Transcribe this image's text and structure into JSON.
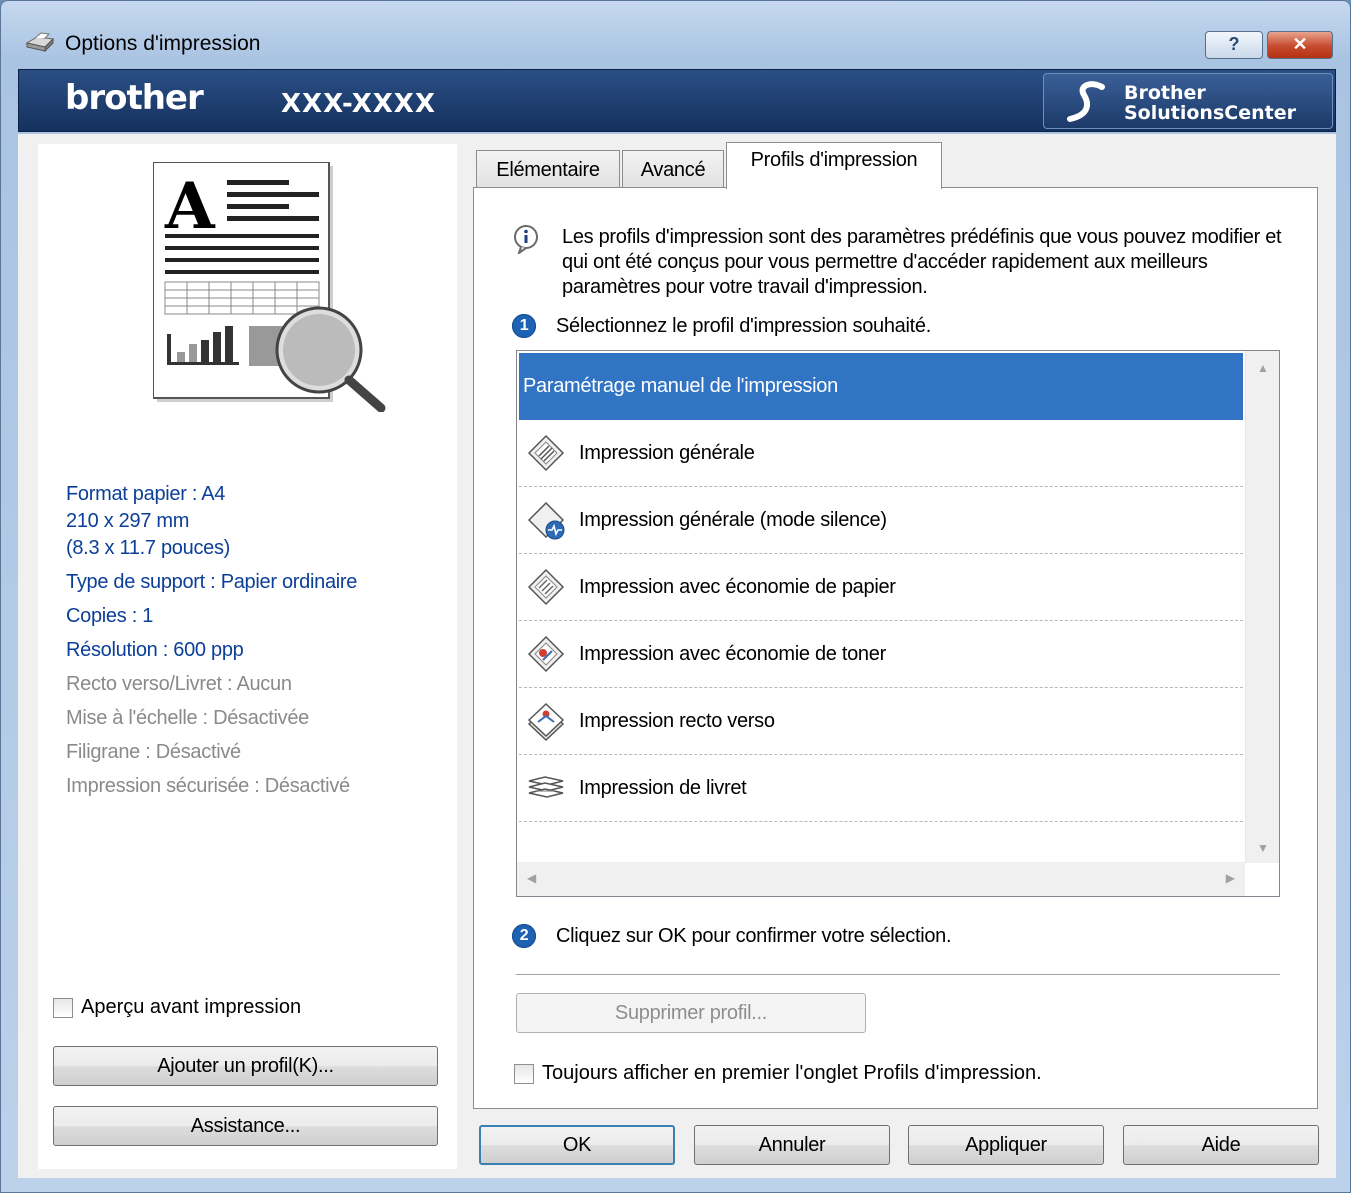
{
  "window": {
    "title": "Options d'impression",
    "help_label": "?",
    "close_label": "✕"
  },
  "banner": {
    "logo": "brother",
    "model": "XXX-XXXX",
    "solutions_line1": "Brother",
    "solutions_line2": "SolutionsCenter"
  },
  "summary": {
    "paper_size": "Format papier : A4",
    "paper_mm": "210 x 297 mm",
    "paper_in": "(8.3 x 11.7 pouces)",
    "media_type": "Type de support : Papier ordinaire",
    "copies": "Copies : 1",
    "resolution": "Résolution : 600 ppp",
    "duplex": "Recto verso/Livret : Aucun",
    "scaling": "Mise à l'échelle : Désactivée",
    "watermark": "Filigrane : Désactivé",
    "secure": "Impression sécurisée : Désactivé"
  },
  "left": {
    "preview_checkbox": "Aperçu avant impression",
    "add_profile": "Ajouter un profil(K)...",
    "support": "Assistance..."
  },
  "tabs": [
    {
      "label": "Elémentaire"
    },
    {
      "label": "Avancé"
    },
    {
      "label": "Profils d'impression"
    }
  ],
  "profiles_tab": {
    "description": "Les profils d'impression sont des paramètres prédéfinis que vous pouvez modifier et qui ont été conçus pour vous permettre d'accéder rapidement aux meilleurs paramètres pour votre travail d'impression.",
    "step1": "Sélectionnez le profil d'impression souhaité.",
    "items": [
      {
        "label": "Paramétrage manuel de l'impression",
        "icon": "none",
        "selected": true
      },
      {
        "label": "Impression générale",
        "icon": "general-print-icon"
      },
      {
        "label": "Impression générale (mode silence)",
        "icon": "quiet-mode-icon"
      },
      {
        "label": "Impression avec économie de papier",
        "icon": "paper-save-icon"
      },
      {
        "label": "Impression avec économie de toner",
        "icon": "toner-save-icon"
      },
      {
        "label": "Impression recto verso",
        "icon": "duplex-icon"
      },
      {
        "label": "Impression de livret",
        "icon": "booklet-icon"
      }
    ],
    "step2": "Cliquez sur OK pour confirmer votre sélection.",
    "delete_profile": "Supprimer profil...",
    "always_show": "Toujours afficher en premier l'onglet Profils d'impression."
  },
  "footer": {
    "ok": "OK",
    "cancel": "Annuler",
    "apply": "Appliquer",
    "help": "Aide"
  },
  "colors": {
    "selection": "#3174c4",
    "summary_blue": "#0c3f98",
    "banner": "#1d3d6e"
  }
}
